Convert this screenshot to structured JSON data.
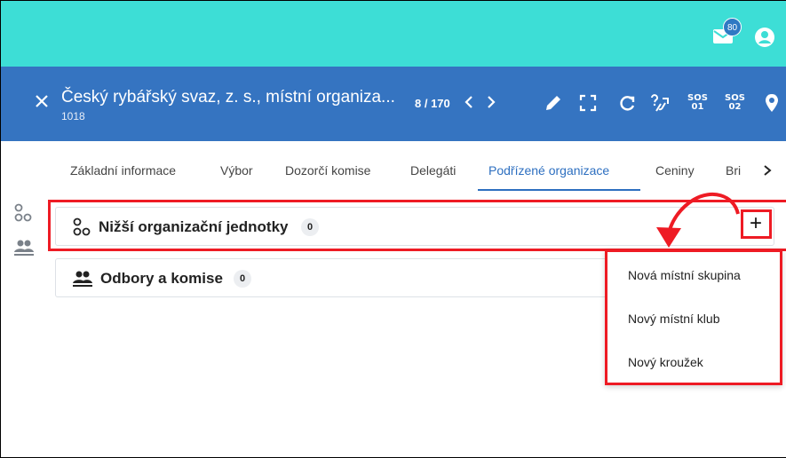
{
  "topbar": {
    "mail_badge": "80",
    "icons": [
      "mail-icon",
      "user-account-icon"
    ],
    "accent": "#3dded6"
  },
  "record": {
    "title": "Český rybářský svaz, z. s., místní organiza...",
    "subtitle": "1018",
    "counter": "8 / 170",
    "sos1": [
      "SOS",
      "01"
    ],
    "sos2": [
      "SOS",
      "02"
    ],
    "background": "#3574c1"
  },
  "tabs": [
    {
      "label": "Základní informace"
    },
    {
      "label": "Výbor"
    },
    {
      "label": "Dozorčí komise"
    },
    {
      "label": "Delegáti"
    },
    {
      "label": "Podřízené organizace",
      "active": true
    },
    {
      "label": "Ceniny"
    },
    {
      "label": "Bri"
    }
  ],
  "panels": [
    {
      "title": "Nižší organizační jednotky",
      "count": "0"
    },
    {
      "title": "Odbory a komise",
      "count": "0"
    }
  ],
  "add_button": "+",
  "menu": {
    "items": [
      "Nová místní skupina",
      "Nový místní klub",
      "Nový kroužek"
    ]
  },
  "highlight_color": "#ee1b24"
}
